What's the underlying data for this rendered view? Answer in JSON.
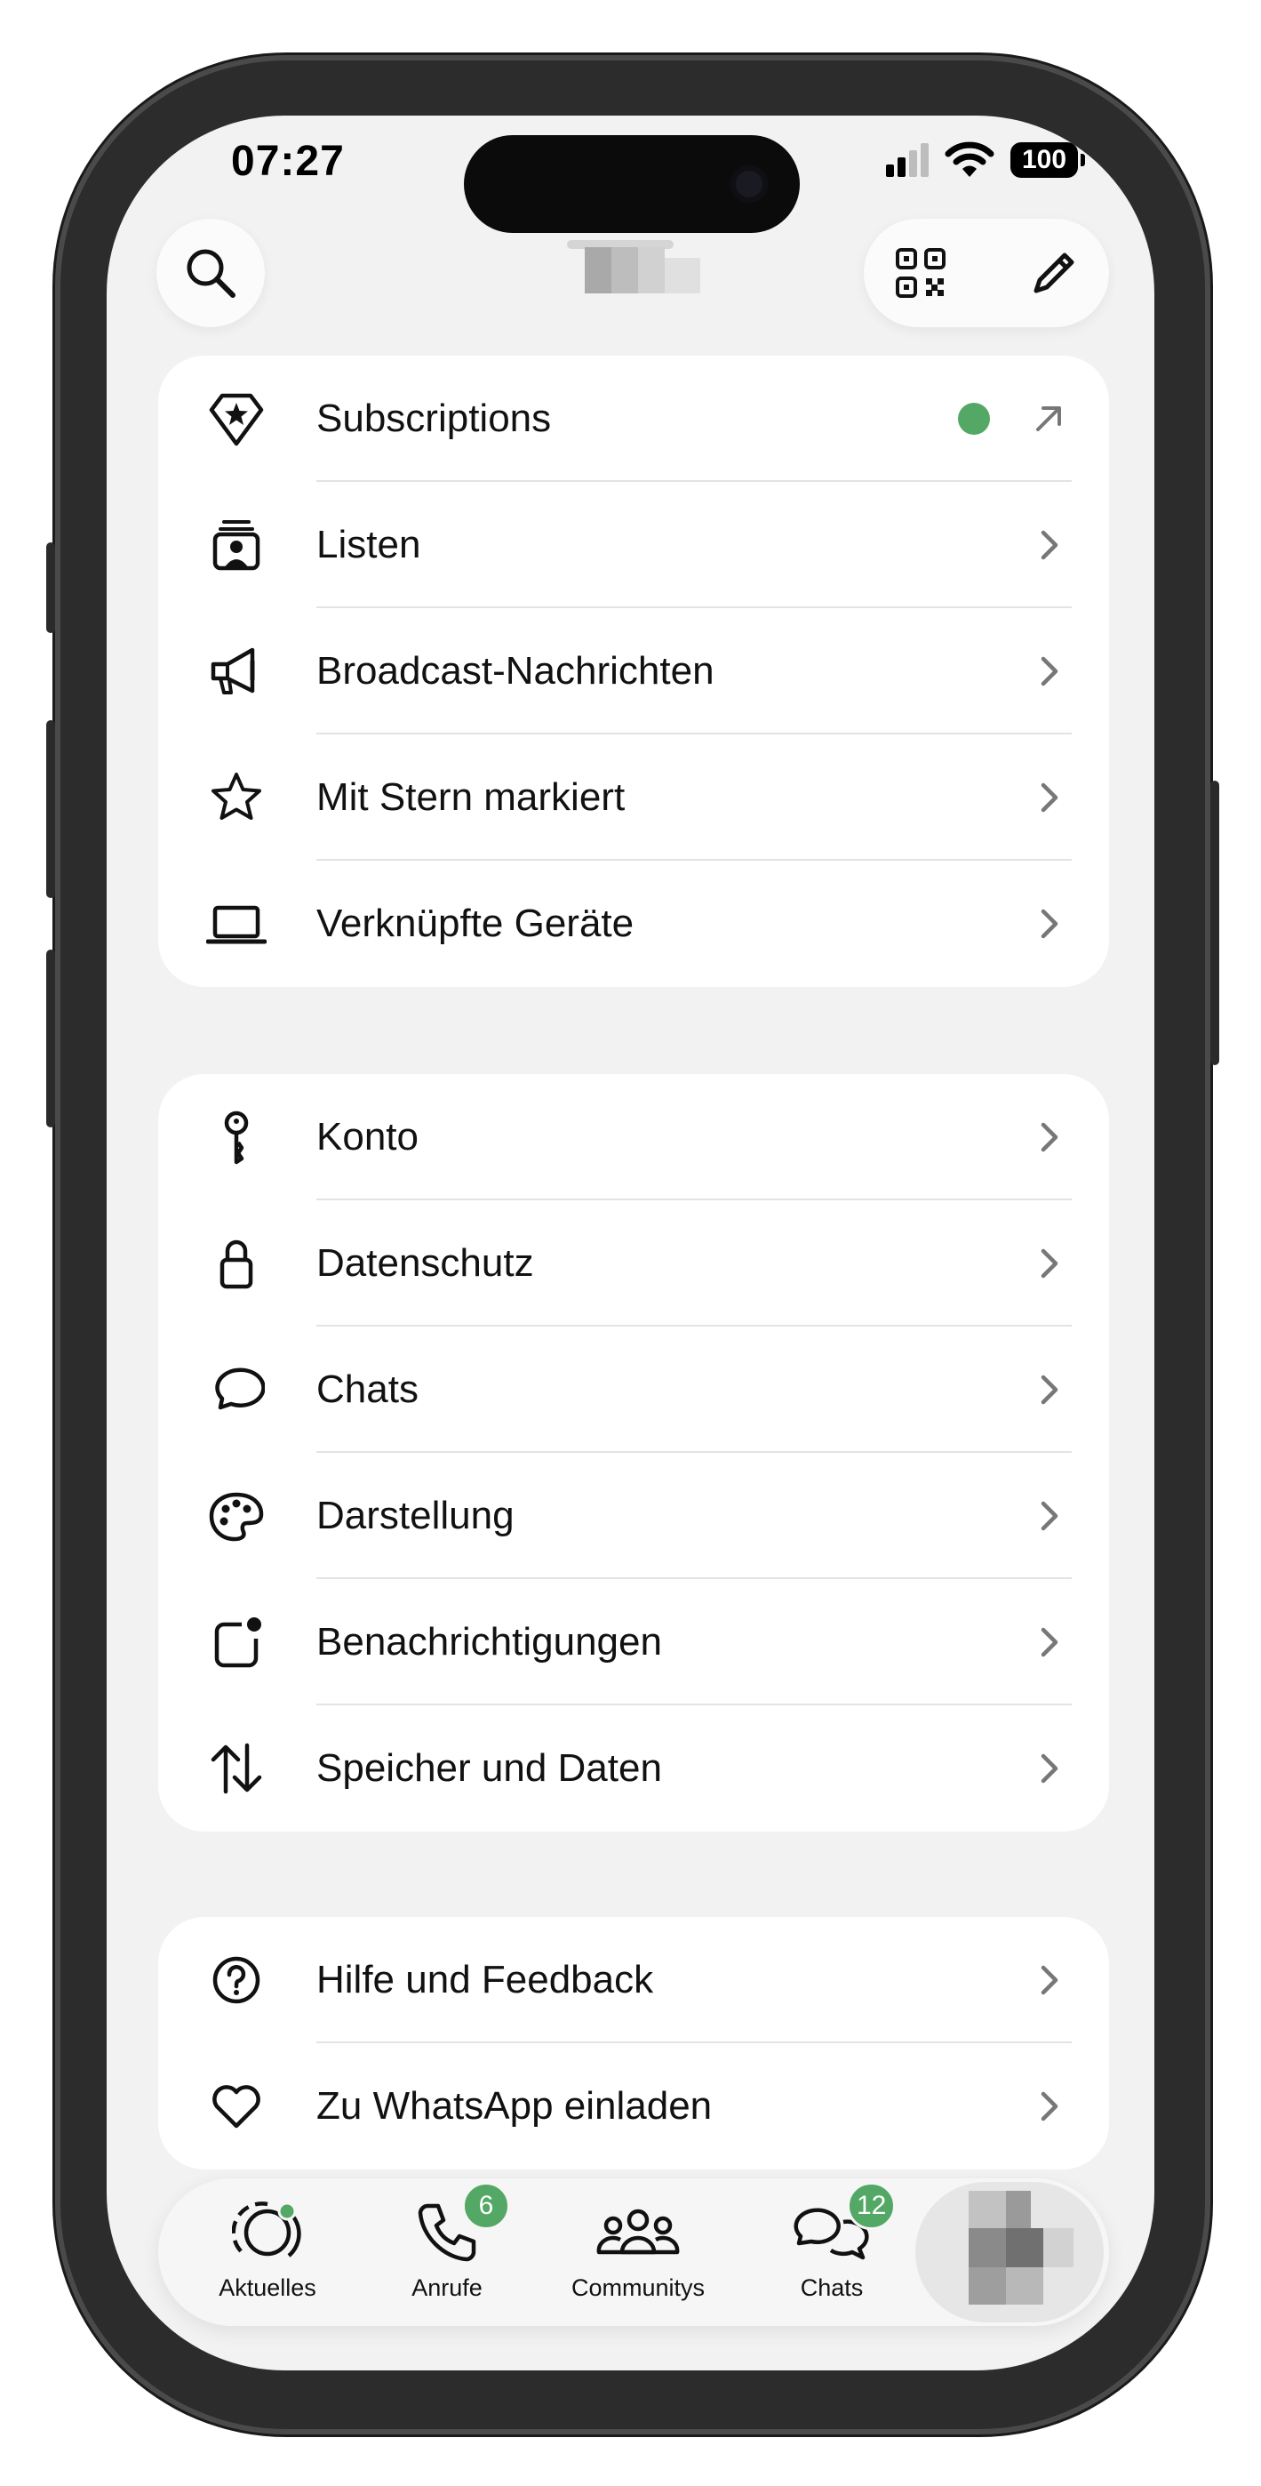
{
  "status_bar": {
    "time": "07:27",
    "battery": "100"
  },
  "header": {
    "search_icon": "search-icon",
    "qr_icon": "qr-code-icon",
    "edit_icon": "pencil-icon"
  },
  "section_1": [
    {
      "label": "Subscriptions",
      "icon": "diamond-star-icon",
      "trailing": "external-link-arrow",
      "status_dot_color": "#54a866"
    },
    {
      "label": "Listen",
      "icon": "contact-list-icon"
    },
    {
      "label": "Broadcast-Nachrichten",
      "icon": "megaphone-icon"
    },
    {
      "label": "Mit Stern markiert",
      "icon": "star-icon"
    },
    {
      "label": "Verknüpfte Geräte",
      "icon": "laptop-icon"
    }
  ],
  "section_2": [
    {
      "label": "Konto",
      "icon": "key-icon"
    },
    {
      "label": "Datenschutz",
      "icon": "lock-icon"
    },
    {
      "label": "Chats",
      "icon": "chat-bubble-icon"
    },
    {
      "label": "Darstellung",
      "icon": "palette-icon"
    },
    {
      "label": "Benachrichtigungen",
      "icon": "notification-icon"
    },
    {
      "label": "Speicher und Daten",
      "icon": "arrows-updown-icon"
    }
  ],
  "section_3": [
    {
      "label": "Hilfe und Feedback",
      "icon": "help-circle-icon"
    },
    {
      "label": "Zu WhatsApp einladen",
      "icon": "heart-icon"
    }
  ],
  "tabbar": {
    "tabs": [
      {
        "label": "Aktuelles",
        "icon": "status-icon"
      },
      {
        "label": "Anrufe",
        "icon": "phone-icon",
        "badge": "6"
      },
      {
        "label": "Communitys",
        "icon": "communities-icon"
      },
      {
        "label": "Chats",
        "icon": "chats-icon",
        "badge": "12"
      }
    ]
  },
  "colors": {
    "accent_green": "#54a866",
    "background": "#f2f2f2",
    "card": "#ffffff"
  }
}
